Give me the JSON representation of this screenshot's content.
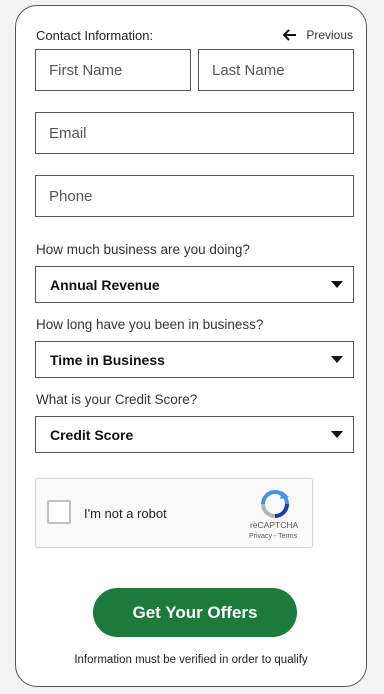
{
  "form": {
    "section_label": "Contact Information:",
    "previous_label": "Previous",
    "first_name_placeholder": "First Name",
    "last_name_placeholder": "Last Name",
    "email_placeholder": "Email",
    "phone_placeholder": "Phone",
    "questions": {
      "revenue": {
        "question": "How much business are you doing?",
        "selected": "Annual Revenue"
      },
      "time": {
        "question": "How long have you been in business?",
        "selected": "Time in Business"
      },
      "credit": {
        "question": "What is your Credit Score?",
        "selected": "Credit Score"
      }
    },
    "captcha": {
      "label": "I'm not a robot",
      "brand": "reCAPTCHA",
      "privacy": "Privacy",
      "separator": " - ",
      "terms": "Terms"
    },
    "submit_label": "Get Your Offers",
    "disclaimer": "Information must be verified in order to qualify"
  },
  "colors": {
    "cta_green": "#1b7a3c",
    "border": "#555555",
    "recaptcha_blue": "#4a90e2"
  },
  "icons": {
    "previous": "arrow-left-icon",
    "dropdown": "caret-down-icon",
    "recaptcha": "recaptcha-logo-icon"
  }
}
